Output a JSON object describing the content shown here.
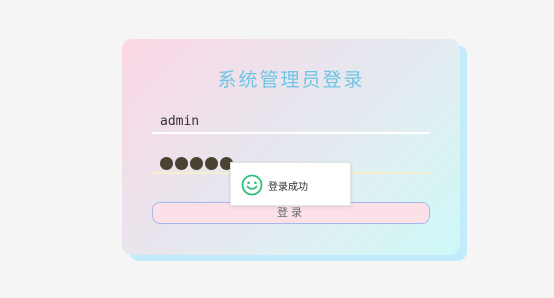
{
  "login_card": {
    "title": "系统管理员登录",
    "username": {
      "value": "admin"
    },
    "password": {
      "masked_length": 5
    },
    "login_button_label": "登录"
  },
  "toast": {
    "icon": "smiley-face-icon",
    "message": "登录成功",
    "icon_color": "#2fbf7a"
  },
  "colors": {
    "title": "#6ec6e4",
    "button_border": "#a7b9ea",
    "button_background": "#fbe0e8"
  }
}
